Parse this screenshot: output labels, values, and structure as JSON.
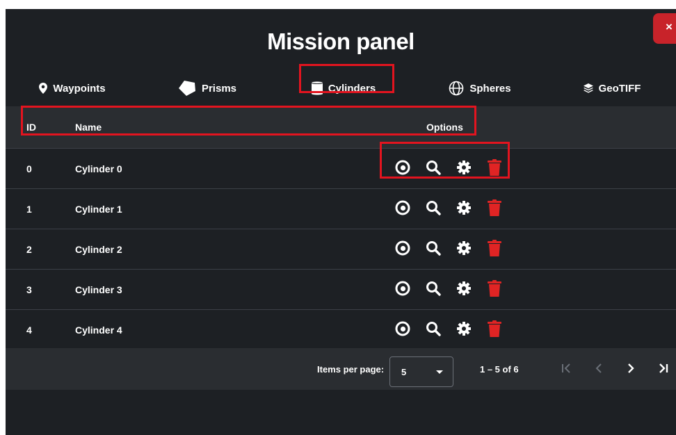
{
  "panel": {
    "title": "Mission panel",
    "close_label": "×"
  },
  "tabs": [
    {
      "label": "Waypoints",
      "icon": "map-pin-icon"
    },
    {
      "label": "Prisms",
      "icon": "pentagon-icon"
    },
    {
      "label": "Cylinders",
      "icon": "cylinder-icon",
      "active": true
    },
    {
      "label": "Spheres",
      "icon": "globe-icon"
    },
    {
      "label": "GeoTIFF",
      "icon": "layers-icon"
    }
  ],
  "table": {
    "headers": {
      "id": "ID",
      "name": "Name",
      "options": "Options"
    },
    "rows": [
      {
        "id": "0",
        "name": "Cylinder 0"
      },
      {
        "id": "1",
        "name": "Cylinder 1"
      },
      {
        "id": "2",
        "name": "Cylinder 2"
      },
      {
        "id": "3",
        "name": "Cylinder 3"
      },
      {
        "id": "4",
        "name": "Cylinder 4"
      }
    ],
    "option_icons": [
      "eye-icon",
      "search-icon",
      "gear-icon",
      "trash-icon"
    ]
  },
  "paginator": {
    "items_per_page_label": "Items per page:",
    "page_size": "5",
    "range_label": "1 – 5 of 6",
    "buttons": [
      "first-page",
      "previous-page",
      "next-page",
      "last-page"
    ]
  },
  "colors": {
    "panel_bg": "#1d2024",
    "header_bg": "#2a2d31",
    "accent_tab": "#8fb3d9",
    "delete_red": "#e02424",
    "close_red": "#c8232a",
    "highlight_red": "#e3141f"
  }
}
